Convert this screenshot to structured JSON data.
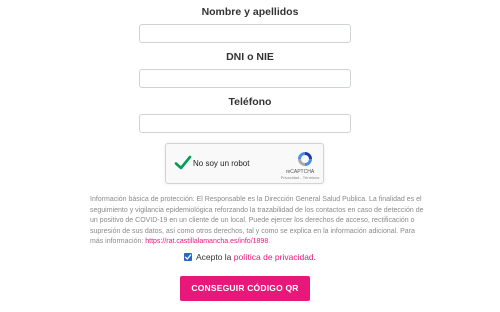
{
  "form": {
    "name_label": "Nombre y apellidos",
    "name_value": "",
    "dni_label": "DNI o NIE",
    "dni_value": "",
    "phone_label": "Teléfono",
    "phone_value": ""
  },
  "recaptcha": {
    "checkbox_label": "No soy un robot",
    "checked": true,
    "brand": "reCAPTCHA",
    "terms": "Privacidad - Términos"
  },
  "info": {
    "text": "Información básica de protección: El Responsable es la Dirección General Salud Publica. La finalidad es el seguimiento y vigilancia epidemiológica reforzando la trazabilidad de los contactos en caso de detección de un positivo de COVID-19 en un cliente de un local. Puede ejercer los derechos de acceso, rectificación o supresión de sus datos, así como otros derechos, tal y como se explica en la información adicional. Para más información:",
    "link": "https://rat.castillalamancha.es/info/1898",
    "link_suffix": "."
  },
  "consent": {
    "checked": true,
    "text": "Acepto la",
    "link": "política de privacidad",
    "suffix": "."
  },
  "submit_label": "CONSEGUIR CÓDIGO QR",
  "colors": {
    "accent": "#e6197a",
    "checkbox": "#2a63c9",
    "captcha_check": "#009e55"
  }
}
